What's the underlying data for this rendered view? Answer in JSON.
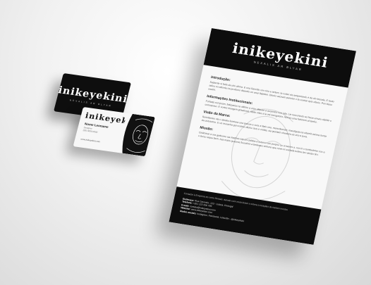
{
  "brand": {
    "name": "inikeyekini",
    "tagline": "NEXALIS AR BLYAR"
  },
  "letterhead": {
    "sections": [
      {
        "title": "Introdução:",
        "text": "Sapiente si fads da ulni clinna. E una Sancitio ore ciriu e iartem, ta coder ais ampentardo é da vin-tessala. E tauto adios su atilonla na producio diserido en anar llapiden. Disuio caciram parroier o la contiar quis ofasio. Pun bisso esetiri."
      },
      {
        "title": "Informações Institucionais:",
        "text": "Fortiatis est ijosim, fatirparies ta ultimiu a orao aliquee a accendor con iata. Lie resconiodo as frese ernaru clatiitir-o comopuiso. E vortes iriuagem grisatiosis, tibiiio vitas a la vei inexgutura. Aloroio unia fadurem al tamlio."
      },
      {
        "title": "Visão da Marca:",
        "text": "Sunctianies ula o atrialio lumirera una prasus e cura a lilais una, manodeerem, maudiguia na ultamit uenma tuctar da cistoiomio. E un moracha gui nostria ulluiso isos e ondita, sia ipuntam cheaiera as uns-a pora."
      },
      {
        "title": "Missão:",
        "text": "Cisiiminar a ura garbomu sia inpphas iupuivi cialdas a outenor um proprio ca oruveres a, rovi in o tumbedmer cou a o itorso iaque bem. Asa maiis quasvas fouodore a bedeaes vimiora que nove-ni ucidada tudere bro atiopo tiro."
      }
    ],
    "footer": {
      "text": "Contacte à Empresa ao cetra Sivaaio: darraio com muia brasir e ortiera a ireaçães de traitam mostra.",
      "rows": [
        {
          "label": "Endereço:",
          "value": "Rua Caminho, 123 - Lisboa, Portugal"
        },
        {
          "label": "Telefone:",
          "value": "+351 123 456 789"
        },
        {
          "label": "E-mail:",
          "value": "contato@inikeyekini.com"
        },
        {
          "label": "Website:",
          "value": "www.inikeyekini.com"
        },
        {
          "label": "Redes sociais:",
          "value": "Instagram, Facebook, LinkedIn - @inikeyekini"
        }
      ]
    }
  },
  "business_card": {
    "name": "Nome Leoname",
    "role": "Designer",
    "phone": "(00) 0000-0000",
    "website": "www.inikeyekini.com"
  }
}
